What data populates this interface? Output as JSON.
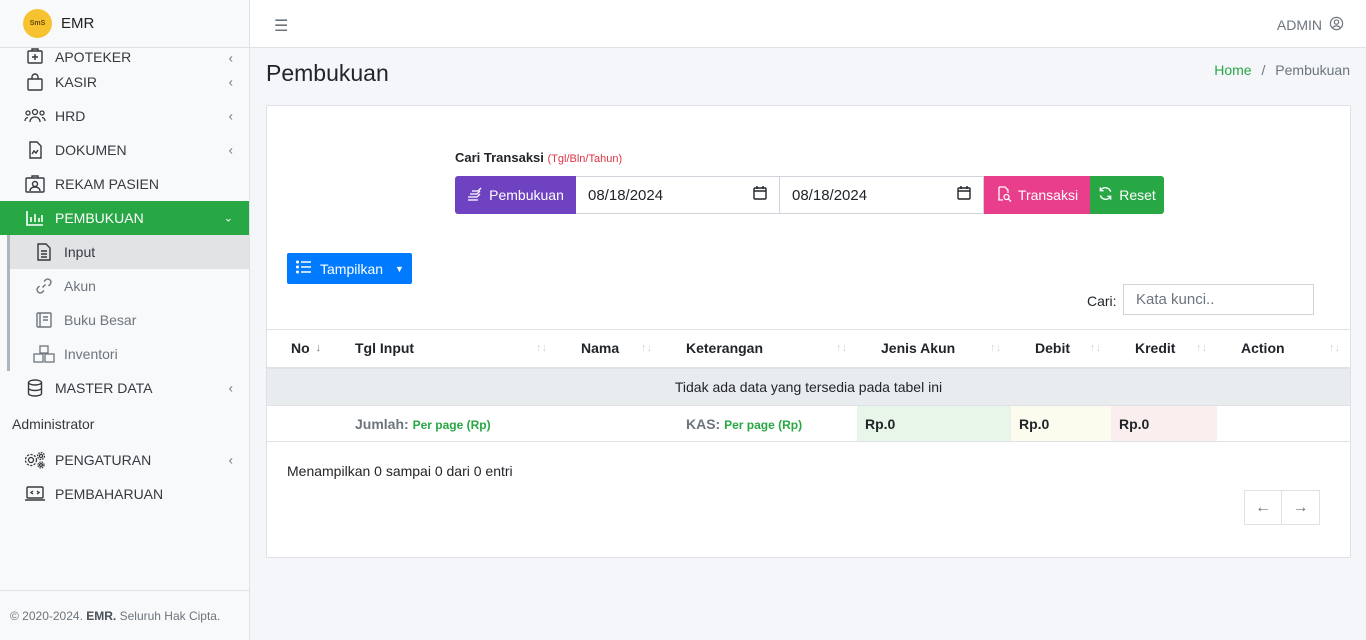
{
  "brand": {
    "name": "EMR",
    "logo_text": "SmS"
  },
  "topbar": {
    "user": "ADMIN"
  },
  "sidebar": {
    "items": [
      {
        "label": "APOTEKER",
        "icon": "medical-kit-icon"
      },
      {
        "label": "KASIR",
        "icon": "shopping-bag-icon"
      },
      {
        "label": "HRD",
        "icon": "people-icon"
      },
      {
        "label": "DOKUMEN",
        "icon": "document-icon"
      },
      {
        "label": "REKAM PASIEN",
        "icon": "patient-record-icon"
      },
      {
        "label": "PEMBUKUAN",
        "icon": "bar-chart-icon"
      }
    ],
    "sub_items": [
      {
        "label": "Input",
        "icon": "file-text-icon"
      },
      {
        "label": "Akun",
        "icon": "link-icon"
      },
      {
        "label": "Buku Besar",
        "icon": "book-icon"
      },
      {
        "label": "Inventori",
        "icon": "boxes-icon"
      }
    ],
    "master_data": "MASTER DATA",
    "section_header": "Administrator",
    "admin_items": [
      {
        "label": "PENGATURAN",
        "icon": "gears-icon"
      },
      {
        "label": "PEMBAHARUAN",
        "icon": "laptop-code-icon"
      }
    ],
    "footer": {
      "prefix": "© 2020-2024.",
      "brand": "EMR.",
      "suffix": "Seluruh Hak Cipta."
    }
  },
  "page": {
    "title": "Pembukuan"
  },
  "breadcrumb": {
    "home": "Home",
    "separator": "/",
    "current": "Pembukuan"
  },
  "search": {
    "label": "Cari Transaksi",
    "hint": "(Tgl/Bln/Tahun)",
    "pembukuan_button": "Pembukuan",
    "date_from": "08/18/2024",
    "date_to": "08/18/2024",
    "transaksi_button": "Transaksi",
    "reset_button": "Reset"
  },
  "tampilkan_button": "Tampilkan",
  "cari": {
    "label": "Cari:",
    "placeholder": "Kata kunci.."
  },
  "table": {
    "columns": [
      "No",
      "Tgl Input",
      "Nama",
      "Keterangan",
      "Jenis Akun",
      "Debit",
      "Kredit",
      "Action"
    ],
    "empty_message": "Tidak ada data yang tersedia pada tabel ini",
    "footer": {
      "jumlah_label": "Jumlah:",
      "jumlah_sub": "Per page (Rp)",
      "kas_label": "KAS:",
      "kas_sub": "Per page (Rp)",
      "jenis_akun_total": "Rp.0",
      "debit_total": "Rp.0",
      "kredit_total": "Rp.0"
    }
  },
  "info": "Menampilkan 0 sampai 0 dari 0 entri",
  "colors": {
    "accent_green": "#28a745",
    "purple": "#6f42c1",
    "pink": "#e83e8c",
    "blue": "#007bff"
  }
}
